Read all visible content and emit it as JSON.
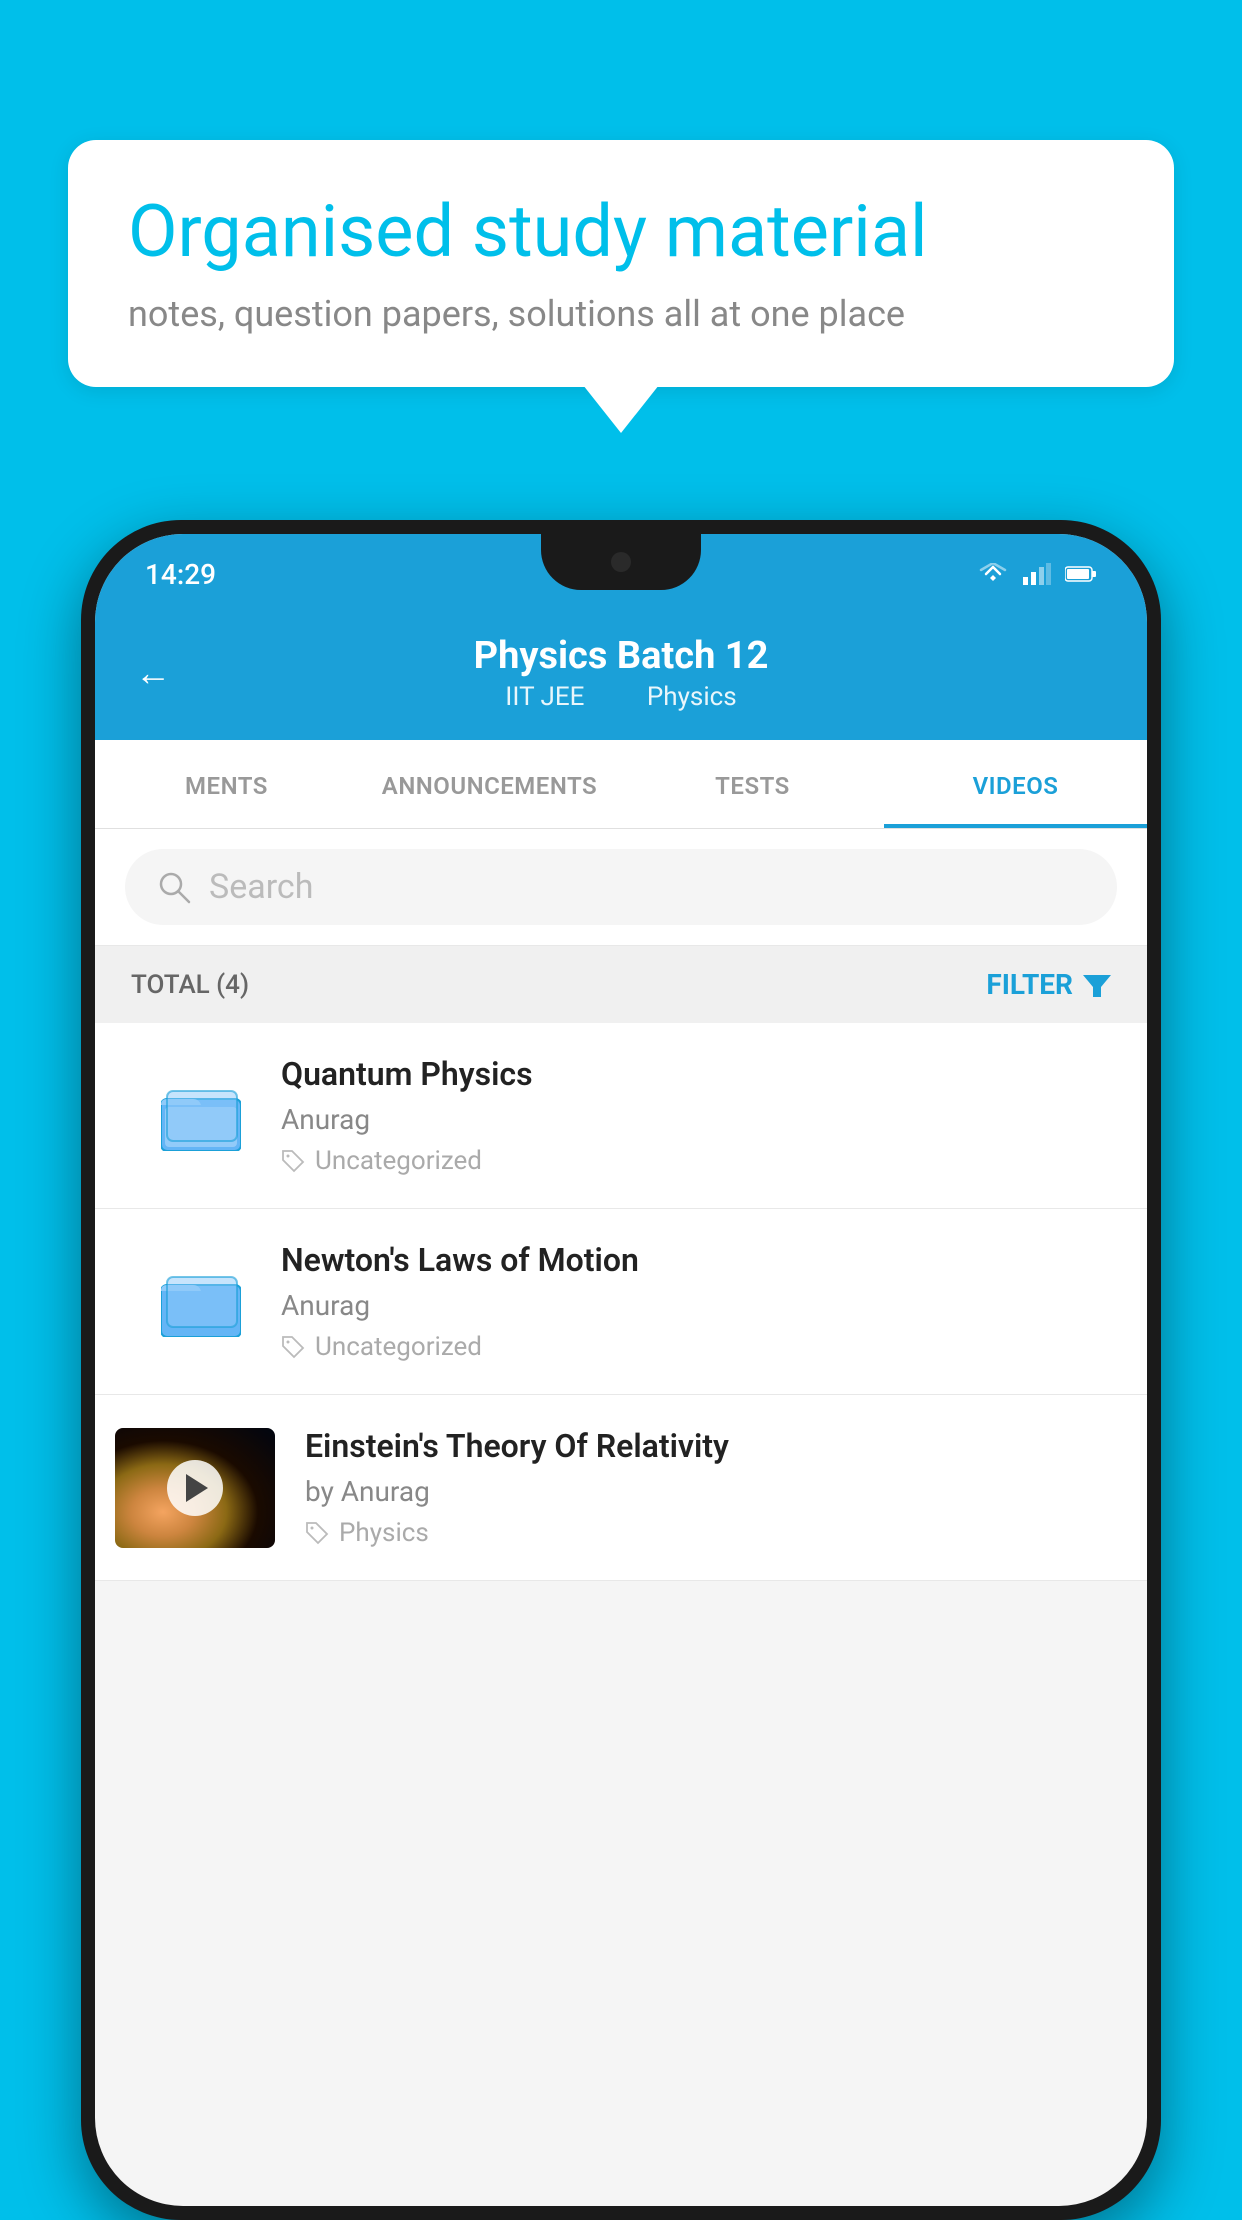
{
  "page": {
    "background_color": "#00BFEA"
  },
  "bubble": {
    "title": "Organised study material",
    "subtitle": "notes, question papers, solutions all at one place"
  },
  "status_bar": {
    "time": "14:29",
    "wifi": "▼",
    "signal": "▲",
    "battery": "▮"
  },
  "header": {
    "back_label": "←",
    "title": "Physics Batch 12",
    "subtitle_left": "IIT JEE",
    "subtitle_right": "Physics"
  },
  "tabs": [
    {
      "id": "ments",
      "label": "MENTS",
      "active": false
    },
    {
      "id": "announcements",
      "label": "ANNOUNCEMENTS",
      "active": false
    },
    {
      "id": "tests",
      "label": "TESTS",
      "active": false
    },
    {
      "id": "videos",
      "label": "VIDEOS",
      "active": true
    }
  ],
  "search": {
    "placeholder": "Search"
  },
  "filter_bar": {
    "total_label": "TOTAL (4)",
    "filter_label": "FILTER"
  },
  "videos": [
    {
      "id": 1,
      "title": "Quantum Physics",
      "author": "Anurag",
      "tag": "Uncategorized",
      "has_thumbnail": false
    },
    {
      "id": 2,
      "title": "Newton's Laws of Motion",
      "author": "Anurag",
      "tag": "Uncategorized",
      "has_thumbnail": false
    },
    {
      "id": 3,
      "title": "Einstein's Theory Of Relativity",
      "author": "by Anurag",
      "tag": "Physics",
      "has_thumbnail": true
    }
  ]
}
